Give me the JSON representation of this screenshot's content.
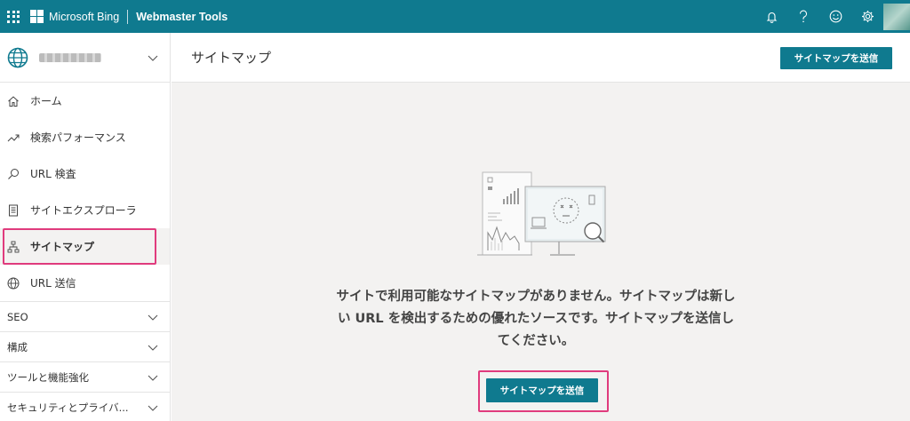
{
  "app": {
    "brand": "Microsoft Bing",
    "product": "Webmaster Tools",
    "accent_color": "#0f7a8f",
    "highlight_color": "#e03b7d"
  },
  "topbar": {
    "icons": [
      "bell-icon",
      "help-icon",
      "smiley-icon",
      "gear-icon"
    ]
  },
  "sidebar": {
    "items": [
      {
        "label": "ホーム",
        "icon": "home-icon"
      },
      {
        "label": "検索パフォーマンス",
        "icon": "trend-icon"
      },
      {
        "label": "URL 検査",
        "icon": "search-icon"
      },
      {
        "label": "サイトエクスプローラ",
        "icon": "document-icon"
      },
      {
        "label": "サイトマップ",
        "icon": "sitemap-icon",
        "active": true
      },
      {
        "label": "URL 送信",
        "icon": "globe-icon"
      }
    ],
    "groups": [
      {
        "label": "SEO"
      },
      {
        "label": "構成"
      },
      {
        "label": "ツールと機能強化"
      },
      {
        "label": "セキュリティとプライバ..."
      }
    ]
  },
  "main": {
    "title": "サイトマップ",
    "submit_button": "サイトマップを送信",
    "empty_message": "サイトで利用可能なサイトマップがありません。サイトマップは新しい URL を検出するための優れたソースです。サイトマップを送信してください。",
    "empty_button": "サイトマップを送信"
  }
}
